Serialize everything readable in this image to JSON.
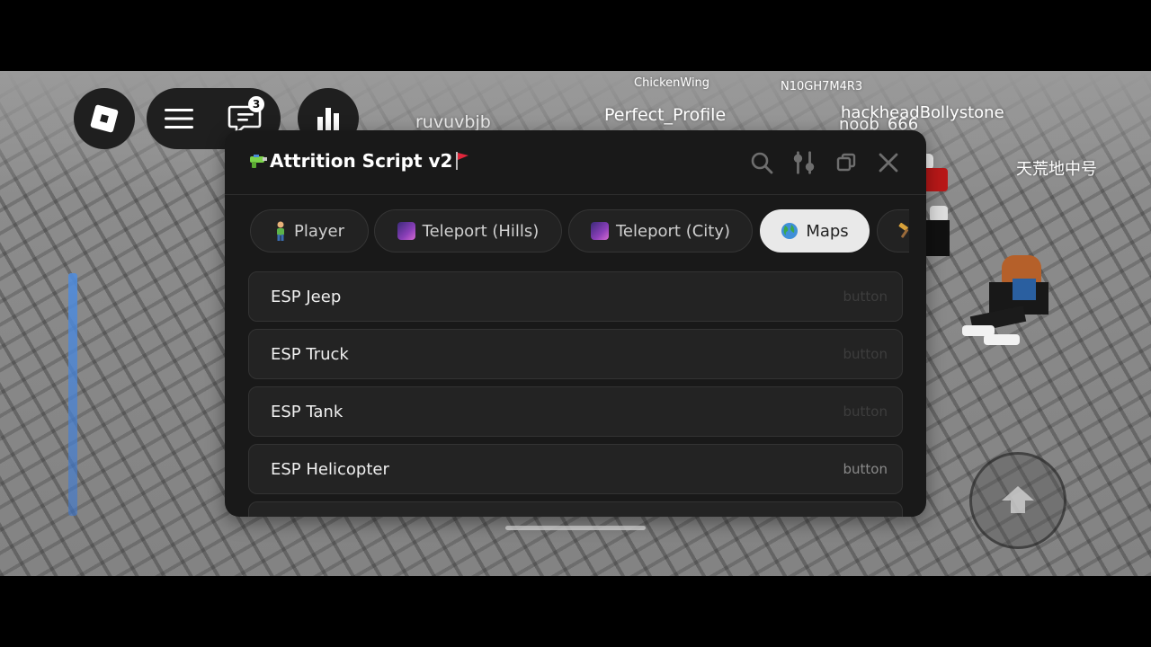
{
  "hud": {
    "chat_badge": "3"
  },
  "nametags": {
    "chicken": "ChickenWing",
    "n10": "N10GH7M4R3",
    "ruvuv": "ruvuvbjb",
    "perfect": "Perfect_Profile",
    "hackhead": "hackheadBollystone",
    "noob": "noob_666",
    "cn": "天荒地中号"
  },
  "window": {
    "title": "Attrition Script v2",
    "tabs": [
      {
        "label": "Player",
        "icon": "person-emoji"
      },
      {
        "label": "Teleport (Hills)",
        "icon": "galaxy-emoji"
      },
      {
        "label": "Teleport (City)",
        "icon": "galaxy-emoji"
      },
      {
        "label": "Maps",
        "icon": "globe-emoji",
        "active": true
      },
      {
        "label": "",
        "icon": "hammer-emoji"
      }
    ],
    "rows": [
      {
        "label": "ESP Jeep",
        "type": "button"
      },
      {
        "label": "ESP Truck",
        "type": "button"
      },
      {
        "label": "ESP Tank",
        "type": "button"
      },
      {
        "label": "ESP Helicopter",
        "type": "button"
      },
      {
        "label": "",
        "type": ""
      }
    ]
  },
  "colors": {
    "window_bg": "#191919",
    "active_tab_bg": "#e9e9e9",
    "row_bg": "#232323"
  }
}
